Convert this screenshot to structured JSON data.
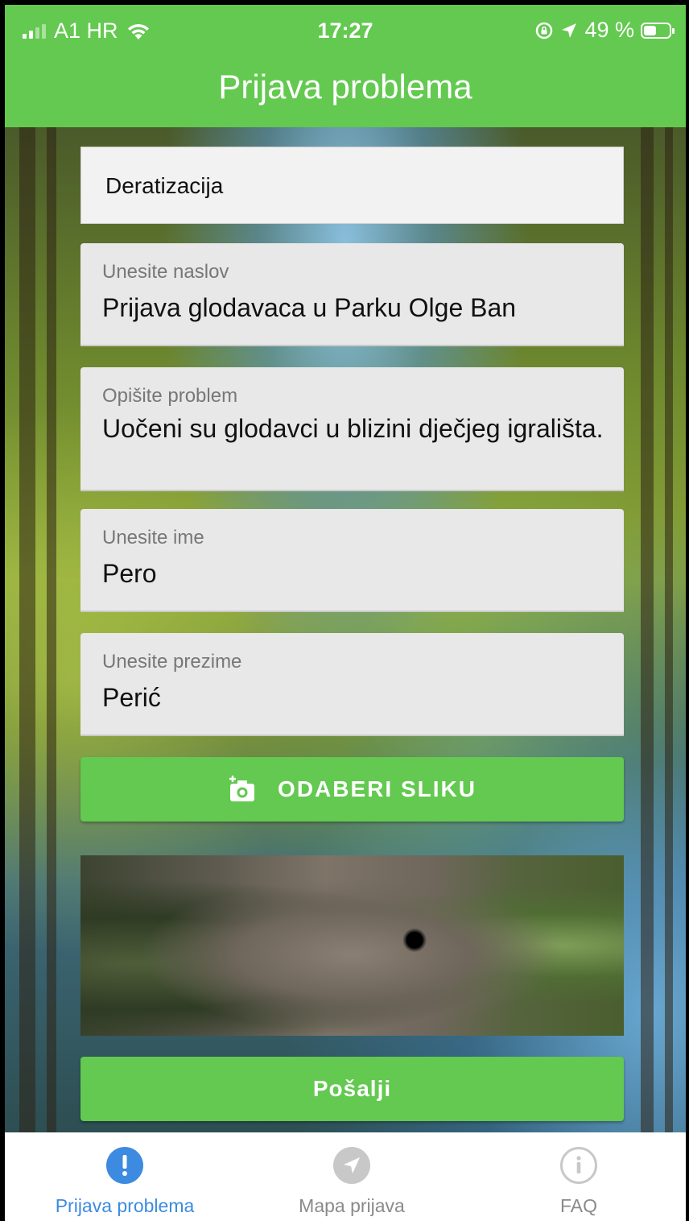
{
  "status_bar": {
    "carrier": "A1 HR",
    "time": "17:27",
    "battery_percent": "49 %",
    "battery_level": 0.49
  },
  "header": {
    "title": "Prijava problema"
  },
  "form": {
    "category": {
      "value": "Deratizacija"
    },
    "title_field": {
      "label": "Unesite naslov",
      "value": "Prijava glodavaca u Parku Olge Ban"
    },
    "description_field": {
      "label": "Opišite problem",
      "value": "Uočeni su glodavci u blizini dječjeg igrališta."
    },
    "first_name_field": {
      "label": "Unesite ime",
      "value": "Pero"
    },
    "last_name_field": {
      "label": "Unesite prezime",
      "value": "Perić"
    },
    "choose_image_button": {
      "label": "ODABERI SLIKU",
      "icon": "add-photo-icon"
    },
    "submit_button": {
      "label": "Pošalji"
    }
  },
  "tabs": [
    {
      "label": "Prijava problema",
      "icon": "exclamation-icon",
      "active": true
    },
    {
      "label": "Mapa prijava",
      "icon": "navigation-arrow-icon",
      "active": false
    },
    {
      "label": "FAQ",
      "icon": "info-icon",
      "active": false
    }
  ],
  "colors": {
    "accent_green": "#63c950",
    "active_tab": "#3d8be0",
    "inactive_tab": "#8a8a8a"
  }
}
